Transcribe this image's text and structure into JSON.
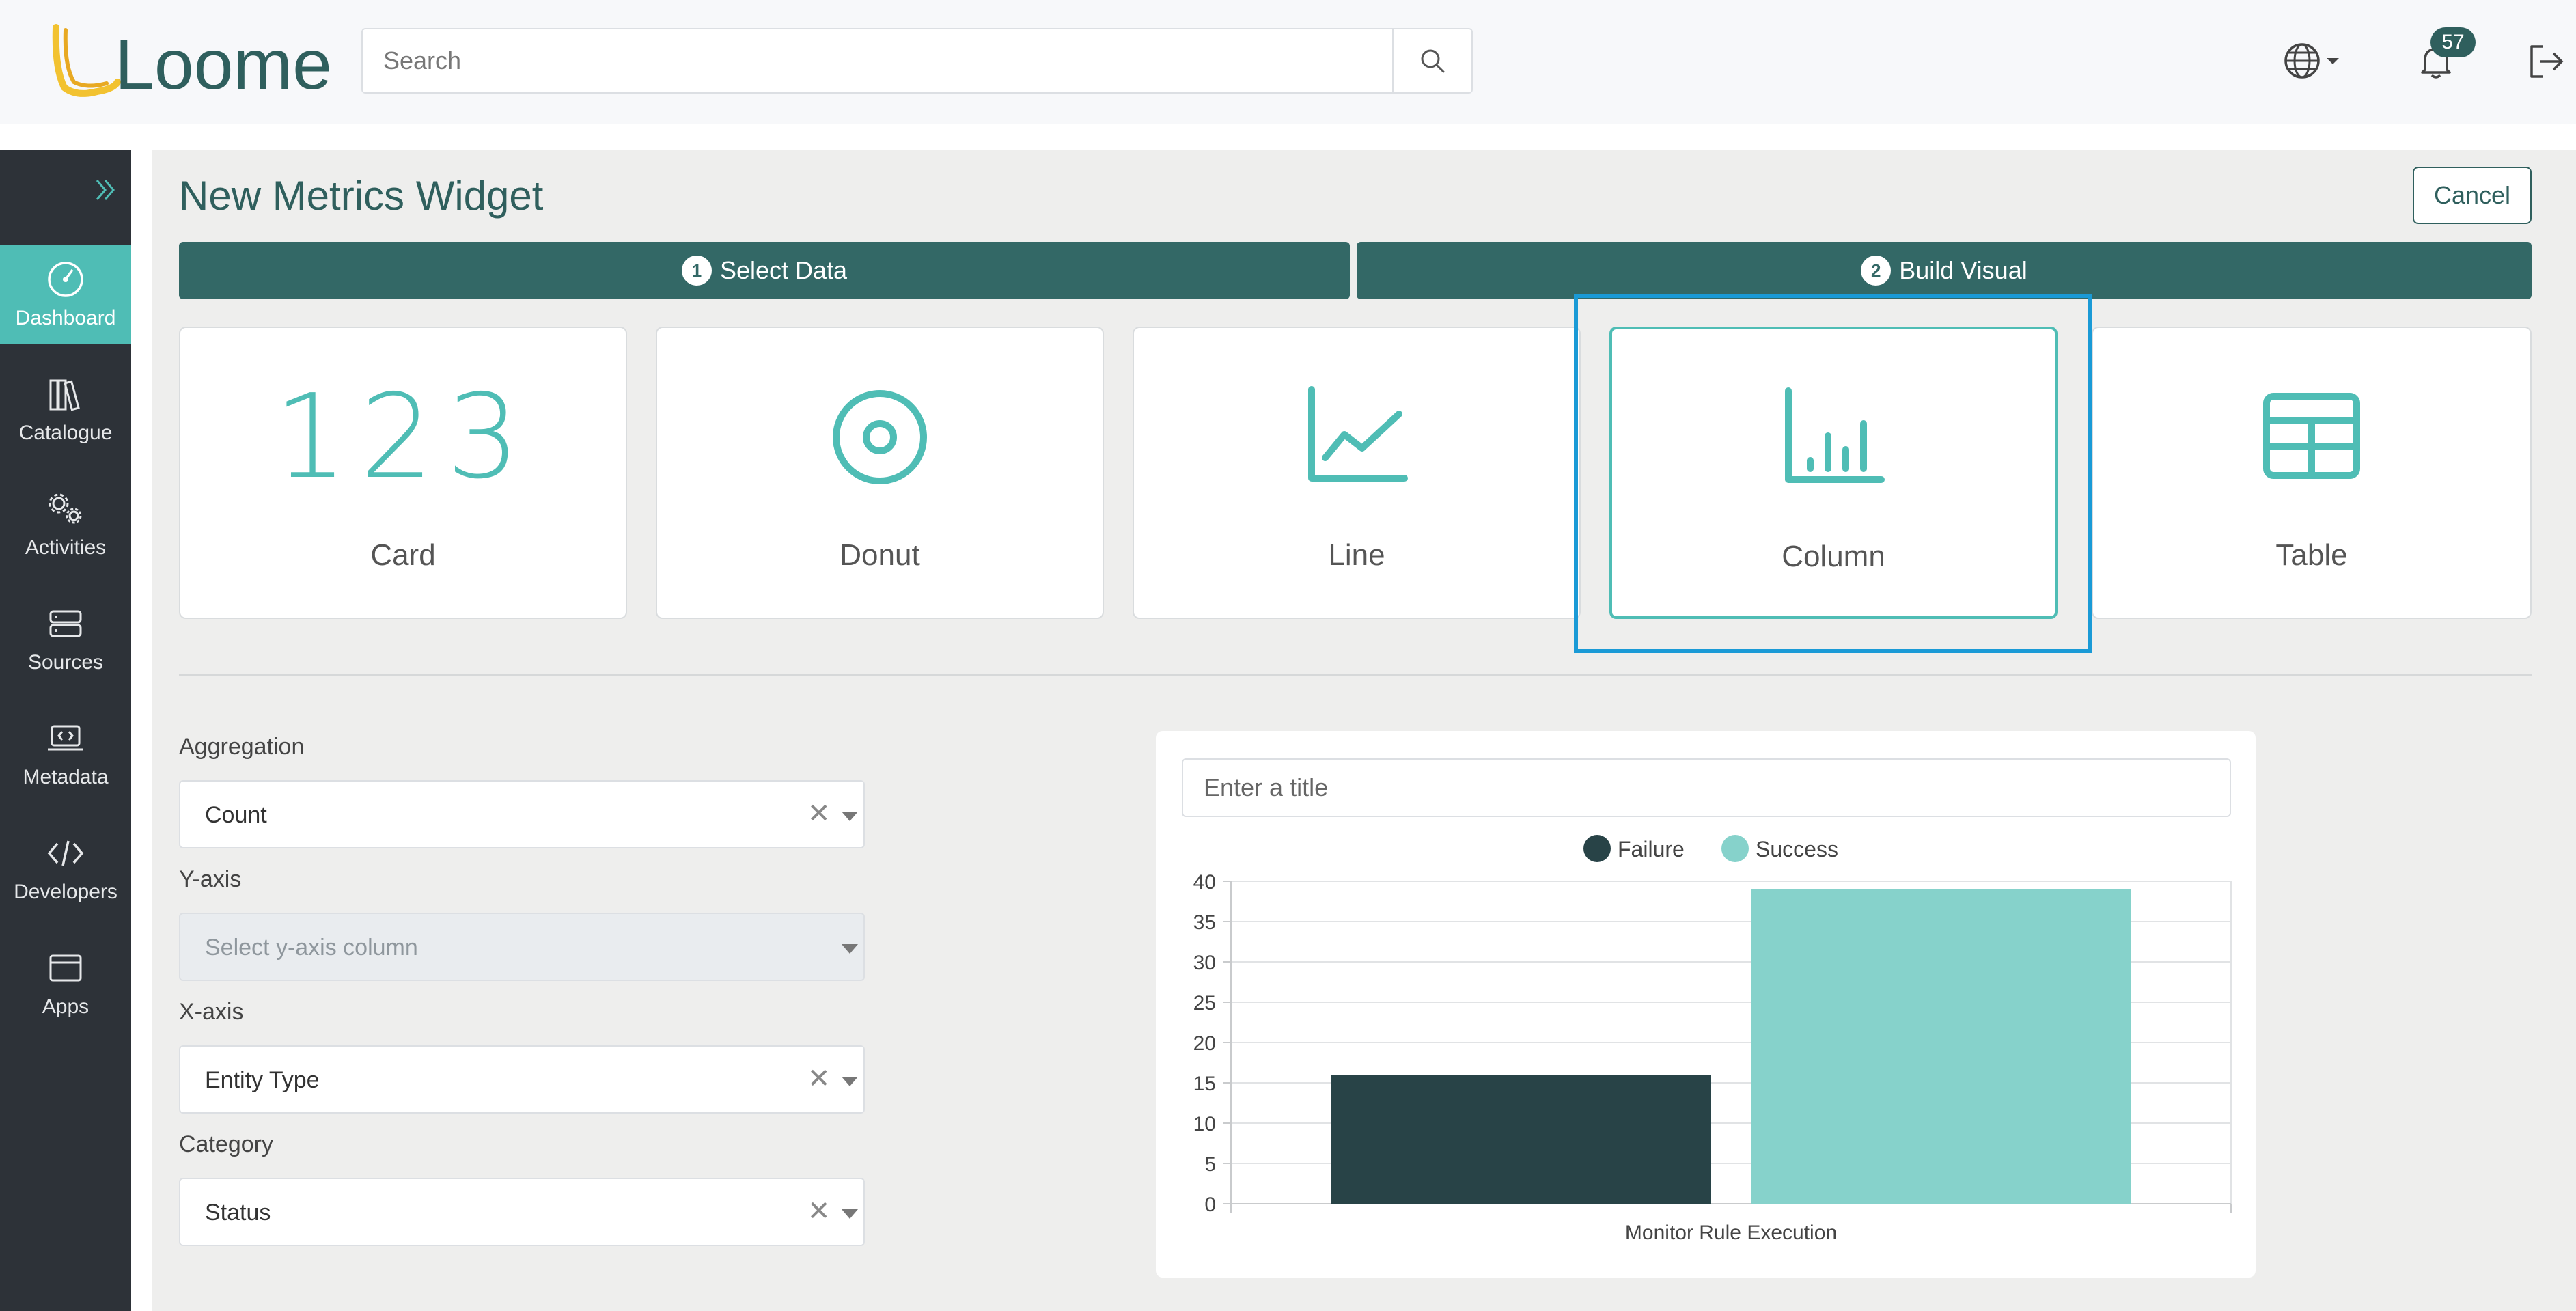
{
  "header": {
    "logo_text": "Loome",
    "search_placeholder": "Search",
    "notification_count": "57"
  },
  "sidebar": {
    "items": [
      {
        "label": "Dashboard",
        "icon": "dashboard-icon",
        "active": true
      },
      {
        "label": "Catalogue",
        "icon": "catalogue-icon"
      },
      {
        "label": "Activities",
        "icon": "activities-icon"
      },
      {
        "label": "Sources",
        "icon": "sources-icon"
      },
      {
        "label": "Metadata",
        "icon": "metadata-icon"
      },
      {
        "label": "Developers",
        "icon": "developers-icon"
      },
      {
        "label": "Apps",
        "icon": "apps-icon"
      }
    ]
  },
  "page": {
    "title": "New Metrics Widget",
    "cancel_label": "Cancel"
  },
  "steps": [
    {
      "number": "1",
      "label": "Select Data"
    },
    {
      "number": "2",
      "label": "Build Visual"
    }
  ],
  "visual_types": [
    {
      "label": "Card",
      "icon_text": "123"
    },
    {
      "label": "Donut",
      "icon": "donut-icon"
    },
    {
      "label": "Line",
      "icon": "line-chart-icon"
    },
    {
      "label": "Column",
      "icon": "column-chart-icon",
      "selected": true
    },
    {
      "label": "Table",
      "icon": "table-icon"
    }
  ],
  "form": {
    "aggregation": {
      "label": "Aggregation",
      "value": "Count"
    },
    "y_axis": {
      "label": "Y-axis",
      "placeholder": "Select y-axis column"
    },
    "x_axis": {
      "label": "X-axis",
      "value": "Entity Type"
    },
    "category": {
      "label": "Category",
      "value": "Status"
    }
  },
  "preview": {
    "title_placeholder": "Enter a title"
  },
  "colors": {
    "accent": "#4fbdb5",
    "primary": "#336866",
    "failure": "#284347",
    "success": "#86d2cb",
    "selection": "#1a9ad6"
  },
  "chart_data": {
    "type": "bar",
    "categories": [
      "Monitor Rule Execution"
    ],
    "series": [
      {
        "name": "Failure",
        "values": [
          16
        ],
        "color": "#284347"
      },
      {
        "name": "Success",
        "values": [
          39
        ],
        "color": "#86d2cb"
      }
    ],
    "ylim": [
      0,
      40
    ],
    "yticks": [
      0,
      5,
      10,
      15,
      20,
      25,
      30,
      35,
      40
    ],
    "legend_position": "top-center",
    "grid": true
  }
}
